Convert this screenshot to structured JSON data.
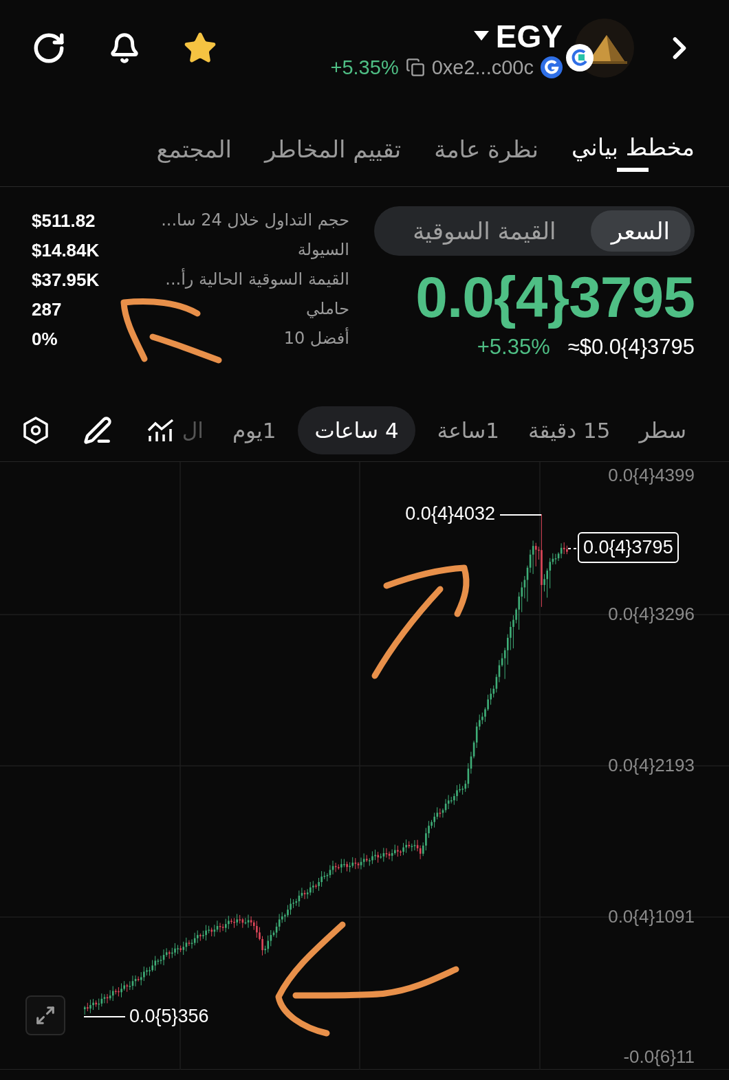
{
  "header": {
    "symbol": "EGY",
    "change": "+5.35%",
    "address": "0xe2...c00c",
    "favorite": true
  },
  "tabs": [
    {
      "label": "مخطط بياني",
      "selected": true
    },
    {
      "label": "نظرة عامة",
      "selected": false
    },
    {
      "label": "تقييم المخاطر",
      "selected": false
    },
    {
      "label": "المجتمع",
      "selected": false
    }
  ],
  "price_toggle": [
    {
      "label": "السعر",
      "selected": true
    },
    {
      "label": "القيمة السوقية",
      "selected": false
    }
  ],
  "price": "0.0{4}3795",
  "price_change": "+5.35%",
  "usd_price": "≈$0.0{4}3795",
  "stats": [
    {
      "label": "حجم التداول خلال 24 سا...",
      "value": "$511.82"
    },
    {
      "label": "السيولة",
      "value": "$14.84K"
    },
    {
      "label": "القيمة السوقية الحالية رأ...",
      "value": "$37.95K"
    },
    {
      "label": "حاملي",
      "value": "287"
    },
    {
      "label": "أفضل 10",
      "value": "0%"
    }
  ],
  "intervals": [
    {
      "label": "سطر",
      "selected": false
    },
    {
      "label": "15 دقيقة",
      "selected": false
    },
    {
      "label": "1ساعة",
      "selected": false
    },
    {
      "label": "4 ساعات",
      "selected": true
    },
    {
      "label": "1يوم",
      "selected": false
    },
    {
      "label": "ال",
      "selected": false
    }
  ],
  "chart": {
    "y_labels": [
      "0.0{4}4399",
      "0.0{4}3296",
      "0.0{4}2193",
      "0.0{4}1091",
      "-0.0{6}11"
    ],
    "high_label": "0.0{4}4032",
    "low_label": "0.0{5}356",
    "current_label": "0.0{4}3795"
  }
}
